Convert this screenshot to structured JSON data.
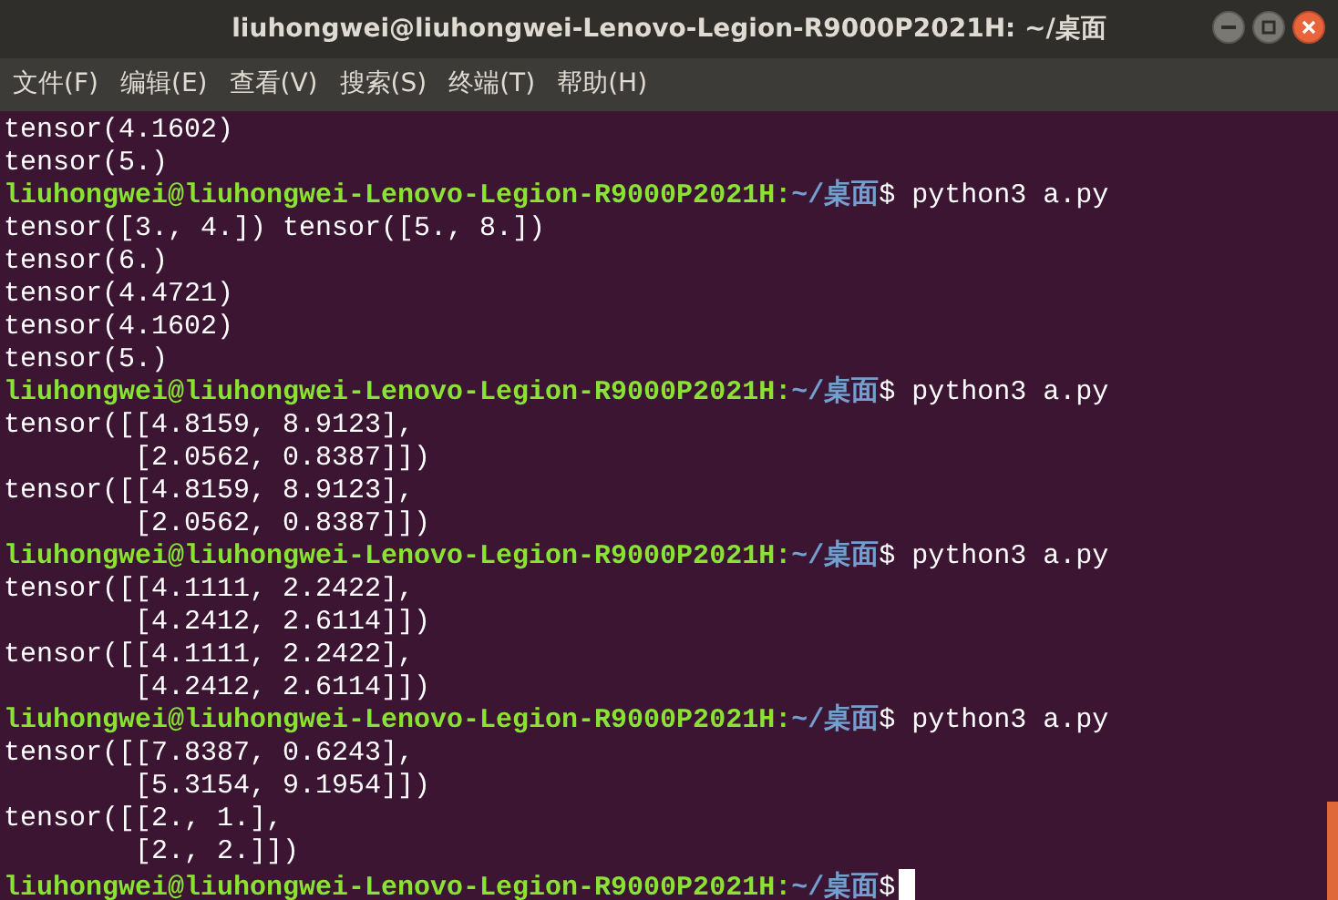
{
  "window": {
    "title": "liuhongwei@liuhongwei-Lenovo-Legion-R9000P2021H: ~/桌面"
  },
  "menu": [
    "文件(F)",
    "编辑(E)",
    "查看(V)",
    "搜索(S)",
    "终端(T)",
    "帮助(H)"
  ],
  "terminal": {
    "lines": [
      {
        "kind": "output",
        "text": "tensor(4.1602)"
      },
      {
        "kind": "output",
        "text": "tensor(5.)"
      },
      {
        "kind": "prompt",
        "user": "liuhongwei@liuhongwei-Lenovo-Legion-R9000P2021H:",
        "path": "~/桌面",
        "sign": "$",
        "command": "python3 a.py"
      },
      {
        "kind": "output",
        "text": "tensor([3., 4.]) tensor([5., 8.])"
      },
      {
        "kind": "output",
        "text": "tensor(6.)"
      },
      {
        "kind": "output",
        "text": "tensor(4.4721)"
      },
      {
        "kind": "output",
        "text": "tensor(4.1602)"
      },
      {
        "kind": "output",
        "text": "tensor(5.)"
      },
      {
        "kind": "prompt",
        "user": "liuhongwei@liuhongwei-Lenovo-Legion-R9000P2021H:",
        "path": "~/桌面",
        "sign": "$",
        "command": "python3 a.py"
      },
      {
        "kind": "output",
        "text": "tensor([[4.8159, 8.9123],"
      },
      {
        "kind": "output",
        "text": "        [2.0562, 0.8387]])"
      },
      {
        "kind": "output",
        "text": "tensor([[4.8159, 8.9123],"
      },
      {
        "kind": "output",
        "text": "        [2.0562, 0.8387]])"
      },
      {
        "kind": "prompt",
        "user": "liuhongwei@liuhongwei-Lenovo-Legion-R9000P2021H:",
        "path": "~/桌面",
        "sign": "$",
        "command": "python3 a.py"
      },
      {
        "kind": "output",
        "text": "tensor([[4.1111, 2.2422],"
      },
      {
        "kind": "output",
        "text": "        [4.2412, 2.6114]])"
      },
      {
        "kind": "output",
        "text": "tensor([[4.1111, 2.2422],"
      },
      {
        "kind": "output",
        "text": "        [4.2412, 2.6114]])"
      },
      {
        "kind": "prompt",
        "user": "liuhongwei@liuhongwei-Lenovo-Legion-R9000P2021H:",
        "path": "~/桌面",
        "sign": "$",
        "command": "python3 a.py"
      },
      {
        "kind": "output",
        "text": "tensor([[7.8387, 0.6243],"
      },
      {
        "kind": "output",
        "text": "        [5.3154, 9.1954]])"
      },
      {
        "kind": "output",
        "text": "tensor([[2., 1.],"
      },
      {
        "kind": "output",
        "text": "        [2., 2.]])"
      },
      {
        "kind": "prompt",
        "user": "liuhongwei@liuhongwei-Lenovo-Legion-R9000P2021H:",
        "path": "~/桌面",
        "sign": "$",
        "cursor": true
      }
    ]
  }
}
